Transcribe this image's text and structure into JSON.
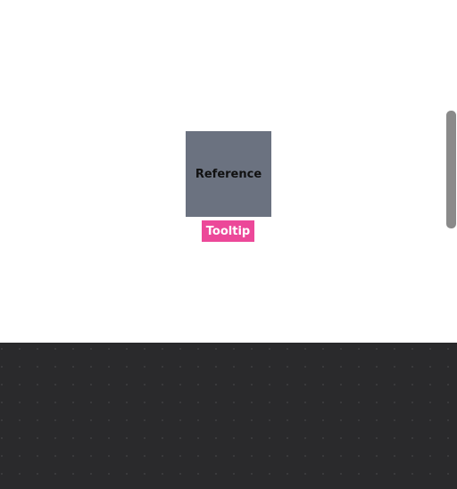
{
  "reference": {
    "label": "Reference"
  },
  "tooltip": {
    "label": "Tooltip"
  },
  "colors": {
    "reference_bg": "#6b7280",
    "tooltip_bg": "#ec4899",
    "panel_bg": "#161617"
  }
}
